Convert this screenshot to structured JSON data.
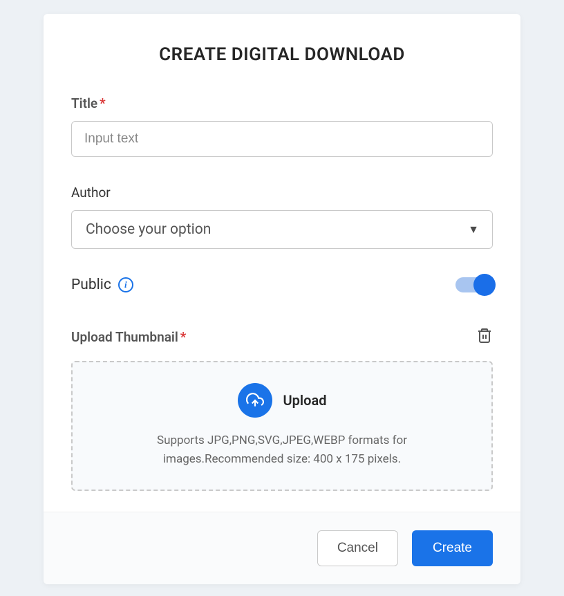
{
  "modal": {
    "title": "CREATE DIGITAL DOWNLOAD",
    "title_field": {
      "label": "Title",
      "placeholder": "Input text",
      "value": ""
    },
    "author_field": {
      "label": "Author",
      "placeholder": "Choose your option",
      "selected": "Choose your option"
    },
    "public_field": {
      "label": "Public",
      "enabled": true
    },
    "thumbnail_field": {
      "label": "Upload Thumbnail",
      "upload_button": "Upload",
      "hint": "Supports JPG,PNG,SVG,JPEG,WEBP formats for images.Recommended size: 400 x 175 pixels."
    },
    "footer": {
      "cancel": "Cancel",
      "create": "Create"
    }
  }
}
